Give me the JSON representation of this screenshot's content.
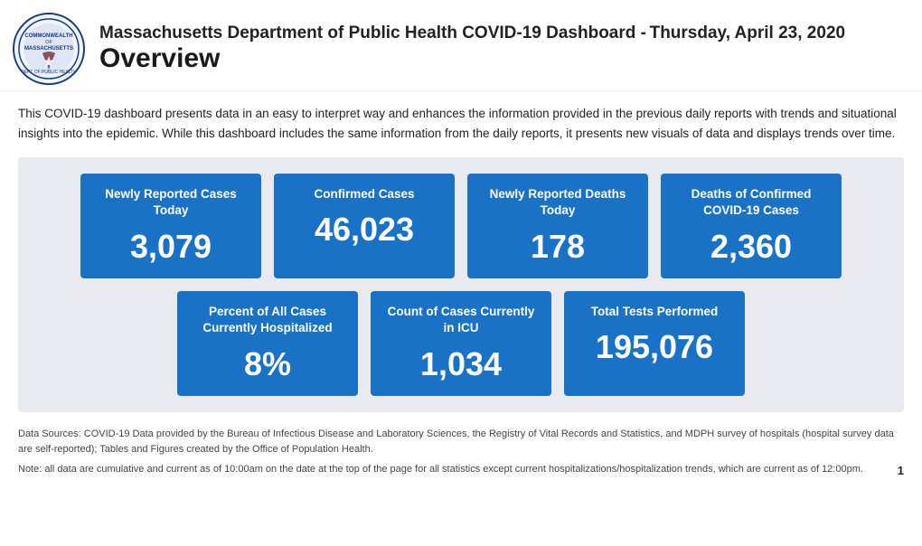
{
  "header": {
    "title": "Massachusetts Department of Public Health COVID-19 Dashboard -",
    "date": "Thursday, April 23, 2020",
    "subtitle": "Overview"
  },
  "description": "This COVID-19 dashboard presents data in an easy to interpret way and enhances the information provided in the previous daily reports with trends and situational insights into the epidemic. While this dashboard includes the same information from the daily reports, it presents new visuals of data and displays trends over time.",
  "stats": {
    "row1": [
      {
        "label": "Newly Reported Cases Today",
        "value": "3,079"
      },
      {
        "label": "Confirmed Cases",
        "value": "46,023"
      },
      {
        "label": "Newly Reported Deaths Today",
        "value": "178"
      },
      {
        "label": "Deaths of Confirmed COVID-19 Cases",
        "value": "2,360"
      }
    ],
    "row2": [
      {
        "label": "Percent of All Cases Currently Hospitalized",
        "value": "8%"
      },
      {
        "label": "Count of Cases Currently in ICU",
        "value": "1,034"
      },
      {
        "label": "Total Tests Performed",
        "value": "195,076"
      }
    ]
  },
  "footer": {
    "sources": "Data Sources: COVID-19 Data provided by the Bureau of Infectious Disease and Laboratory Sciences, the Registry of Vital Records and Statistics, and MDPH survey of hospitals (hospital survey data are self-reported); Tables and Figures created by the Office of Population Health.",
    "note": "Note: all data are cumulative and current as of 10:00am on the date at the top of the page for all statistics except current hospitalizations/hospitalization trends, which are current as of 12:00pm.",
    "page": "1"
  }
}
